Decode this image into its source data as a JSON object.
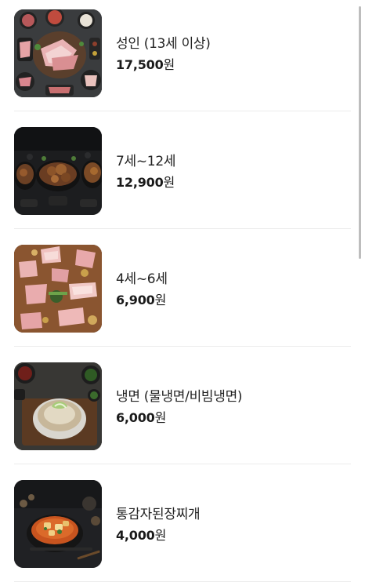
{
  "menu": {
    "items": [
      {
        "name": "성인 (13세 이상)",
        "price": "17,500",
        "unit": "원",
        "image_icon": "grilled-pork-platter-icon"
      },
      {
        "name": "7세~12세",
        "price": "12,900",
        "unit": "원",
        "image_icon": "grilled-meat-table-icon"
      },
      {
        "name": "4세~6세",
        "price": "6,900",
        "unit": "원",
        "image_icon": "pork-belly-spread-icon"
      },
      {
        "name": "냉면 (물냉면/비빔냉면)",
        "price": "6,000",
        "unit": "원",
        "image_icon": "cold-noodle-bowl-icon"
      },
      {
        "name": "통감자된장찌개",
        "price": "4,000",
        "unit": "원",
        "image_icon": "soybean-stew-icon"
      }
    ]
  }
}
